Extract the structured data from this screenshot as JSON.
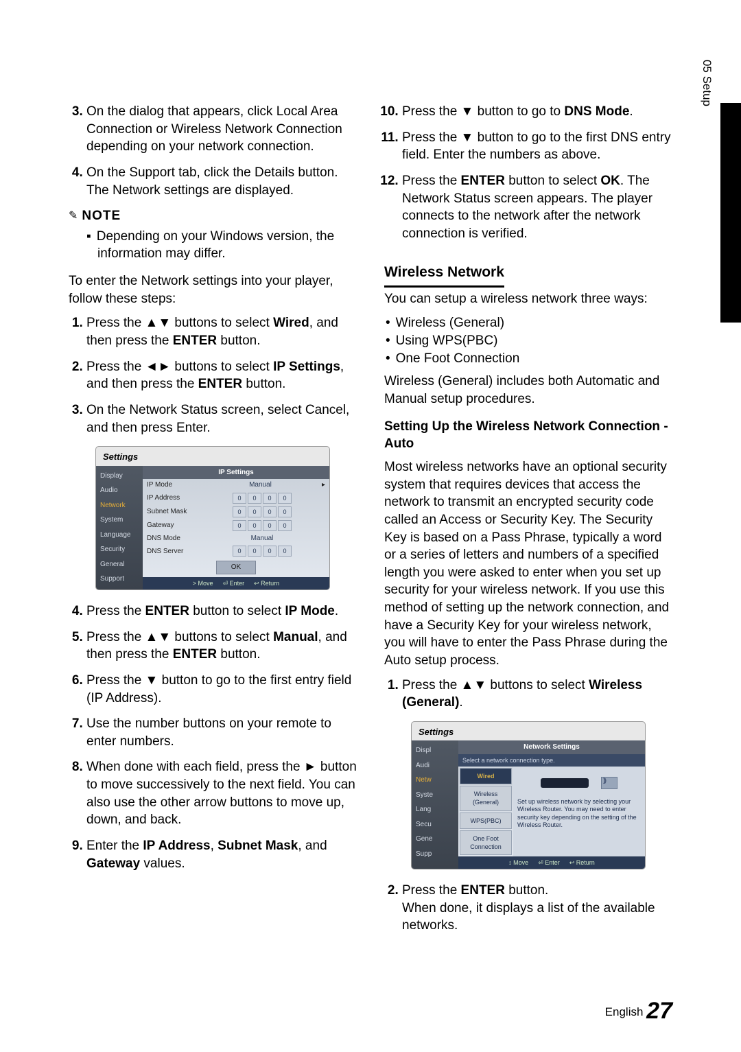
{
  "side_tab": "05  Setup",
  "left": {
    "list_a": [
      {
        "n": "3.",
        "text_a": "On the dialog that appears, click Local Area Connection or Wireless Network Connection depending on your network connection."
      },
      {
        "n": "4.",
        "text_a": "On the Support tab, click the Details button. The Network settings are displayed."
      }
    ],
    "note_label": "NOTE",
    "note_item": "Depending on your Windows version, the information may differ.",
    "para_intro": "To enter the Network settings into your player, follow these steps:",
    "list_b": [
      {
        "n": "1.",
        "pre": "Press the ▲▼ buttons to select ",
        "bold": "Wired",
        "post": ", and then press the ",
        "bold2": "ENTER",
        "post2": " button."
      },
      {
        "n": "2.",
        "pre": "Press the ◄► buttons to select ",
        "bold": "IP Settings",
        "post": ", and then press the ",
        "bold2": "ENTER",
        "post2": " button."
      },
      {
        "n": "3.",
        "pre": "On the Network Status screen, select Cancel, and then press Enter.",
        "bold": "",
        "post": "",
        "bold2": "",
        "post2": ""
      }
    ],
    "list_c": [
      {
        "n": "4.",
        "pre": "Press the ",
        "bold": "ENTER",
        "post": " button to select ",
        "bold2": "IP Mode",
        "post2": "."
      },
      {
        "n": "5.",
        "pre": "Press the ▲▼ buttons to select ",
        "bold": "Manual",
        "post": ", and then press the ",
        "bold2": "ENTER",
        "post2": " button."
      },
      {
        "n": "6.",
        "pre": "Press the ▼ button to go to the first entry field (IP Address).",
        "bold": "",
        "post": "",
        "bold2": "",
        "post2": ""
      },
      {
        "n": "7.",
        "pre": "Use the number buttons on your remote to enter numbers.",
        "bold": "",
        "post": "",
        "bold2": "",
        "post2": ""
      },
      {
        "n": "8.",
        "pre": "When done with each field, press the ► button to move successively to the next field. You can also use the other arrow buttons to move up, down, and back.",
        "bold": "",
        "post": "",
        "bold2": "",
        "post2": ""
      },
      {
        "n": "9.",
        "pre": "Enter the ",
        "bold": "IP Address",
        "post": ", ",
        "bold2": "Subnet Mask",
        "post2": ", and ",
        "bold3": "Gateway",
        "post3": " values."
      }
    ]
  },
  "ui1": {
    "title": "Settings",
    "side": [
      "Display",
      "Audio",
      "Network",
      "System",
      "Language",
      "Security",
      "General",
      "Support"
    ],
    "panel_title": "IP Settings",
    "rows": [
      {
        "lbl": "IP Mode",
        "type": "txt",
        "val": "Manual"
      },
      {
        "lbl": "IP Address",
        "type": "oct"
      },
      {
        "lbl": "Subnet Mask",
        "type": "oct"
      },
      {
        "lbl": "Gateway",
        "type": "oct"
      },
      {
        "lbl": "DNS Mode",
        "type": "txt",
        "val": "Manual"
      },
      {
        "lbl": "DNS Server",
        "type": "oct"
      }
    ],
    "ok": "OK",
    "footer": [
      "> Move",
      "⏎ Enter",
      "↩ Return"
    ]
  },
  "right": {
    "list_a": [
      {
        "n": "10.",
        "pre": "Press the ▼ button to go to ",
        "bold": "DNS Mode",
        "post": "."
      },
      {
        "n": "11.",
        "pre": "Press the ▼ button to go to the first DNS entry field. Enter the numbers as above.",
        "bold": "",
        "post": ""
      },
      {
        "n": "12.",
        "pre": "Press the ",
        "bold": "ENTER",
        "post": " button to select ",
        "bold2": "OK",
        "post2": ". The Network Status screen appears. The player connects to the network after the network connection is verified."
      }
    ],
    "h3": "Wireless Network",
    "para1": "You can setup a wireless network three ways:",
    "bullets": [
      "Wireless (General)",
      "Using WPS(PBC)",
      "One Foot Connection"
    ],
    "para2": "Wireless (General) includes both Automatic and Manual setup procedures.",
    "h4": "Setting Up the Wireless Network Connection - Auto",
    "para3": "Most wireless networks have an optional security system that requires devices that access the network to transmit an encrypted security code called an Access or Security Key. The Security Key is based on a Pass Phrase, typically a word or a series of letters and numbers of a specified length you were asked to enter when you set up security for your wireless network. If you use this method of setting up the network connection, and have a Security Key for your wireless network, you will have to enter the Pass Phrase during the Auto setup process.",
    "list_b": [
      {
        "n": "1.",
        "pre": "Press the ▲▼ buttons to select ",
        "bold": "Wireless (General)",
        "post": "."
      }
    ],
    "list_c": [
      {
        "n": "2.",
        "pre": "Press the ",
        "bold": "ENTER",
        "post": " button.\nWhen done, it displays a list of the available networks."
      }
    ]
  },
  "ui2": {
    "title": "Settings",
    "side": [
      "Displ",
      "Audi",
      "Netw",
      "Syste",
      "Lang",
      "Secu",
      "Gene",
      "Supp"
    ],
    "panel_title": "Network Settings",
    "prompt": "Select a network connection type.",
    "opts": [
      "Wired",
      "Wireless (General)",
      "WPS(PBC)",
      "One Foot Connection"
    ],
    "desc": "Set up wireless network by selecting your Wireless Router. You may need to enter security key depending on the setting of the Wireless Router.",
    "footer": [
      "↕ Move",
      "⏎ Enter",
      "↩ Return"
    ]
  },
  "footer": {
    "lang": "English",
    "page": "27"
  }
}
